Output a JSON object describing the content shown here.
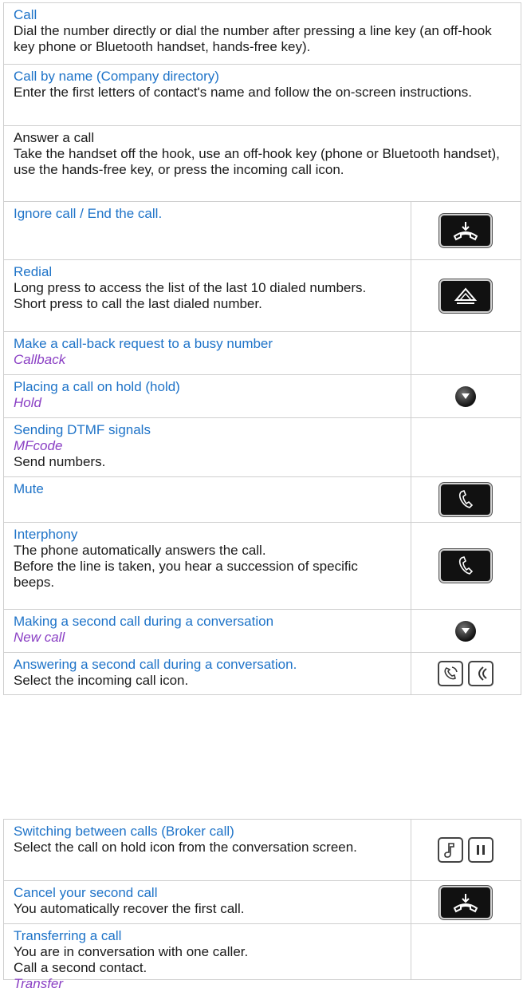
{
  "rows": {
    "call": {
      "title": "Call",
      "body": "Dial the number directly or dial the number after pressing a line key (an off-hook key phone or Bluetooth handset, hands-free key)."
    },
    "call_by_name": {
      "title": "Call by name (Company directory)",
      "body": "Enter the first letters of contact's name and follow the on-screen instructions."
    },
    "answer": {
      "title": "Answer a call",
      "body": "Take the handset off the hook, use an off-hook key (phone or Bluetooth handset), use the hands-free key, or press the incoming call icon."
    },
    "ignore": {
      "title": "Ignore call / End the call.",
      "icon": "hang-up-icon"
    },
    "redial": {
      "title": "Redial",
      "body1": "Long press to access the list of the last 10 dialed numbers.",
      "body2": "Short press to call the last dialed number.",
      "icon": "redial-icon"
    },
    "callback": {
      "title": "Make a call-back request to a busy number",
      "keyword": "Callback"
    },
    "hold": {
      "title": "Placing a call on hold (hold)",
      "keyword": "Hold",
      "icon": "navigation-down-icon"
    },
    "dtmf": {
      "title": "Sending DTMF signals",
      "keyword": "MFcode",
      "body": "Send numbers."
    },
    "mute": {
      "title": "Mute",
      "icon": "mute-icon"
    },
    "interphony": {
      "title": "Interphony",
      "body1": "The phone automatically answers the call.",
      "body2": "Before the line is taken, you hear a succession of specific beeps.",
      "icon": "interphony-icon"
    },
    "second_call": {
      "title": "Making a second call during a conversation",
      "keyword": "New call",
      "icon": "navigation-down-icon"
    },
    "answer_second": {
      "title": "Answering a second call during a conversation.",
      "body": "Select the incoming call icon.",
      "icon": "incoming-call-icon"
    },
    "broker": {
      "title": "Switching between calls (Broker call)",
      "body": "Select the call on hold icon from the conversation screen.",
      "icon": "call-on-hold-icon"
    },
    "cancel_second": {
      "title": "Cancel your second call",
      "body": "You automatically recover the first call.",
      "icon": "hang-up-icon"
    },
    "transfer": {
      "title": "Transferring a call",
      "body1": "You are in conversation with one caller.",
      "body2": "Call a second contact.",
      "keyword": "Transfer"
    }
  },
  "colors": {
    "title": "#1e73c8",
    "keyword": "#8a3fc4",
    "border": "#cfcfcf"
  }
}
